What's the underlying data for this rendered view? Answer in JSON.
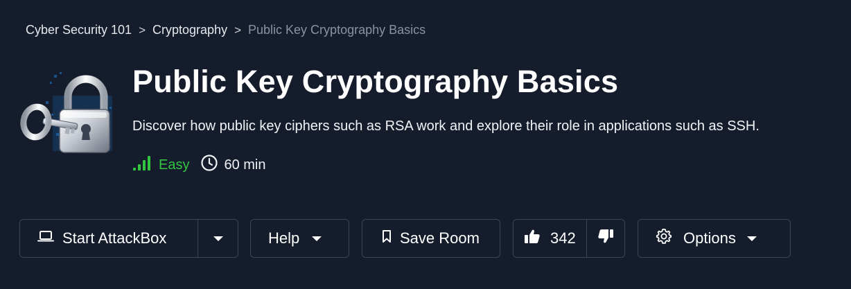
{
  "breadcrumb": {
    "items": [
      "Cyber Security 101",
      "Cryptography",
      "Public Key Cryptography Basics"
    ],
    "separator": ">"
  },
  "room": {
    "title": "Public Key Cryptography Basics",
    "description": "Discover how public key ciphers such as RSA work and explore their role in applications such as SSH.",
    "difficulty": "Easy",
    "duration": "60 min",
    "icon": "padlock-with-key-icon"
  },
  "toolbar": {
    "start_attackbox_label": "Start AttackBox",
    "help_label": "Help",
    "save_room_label": "Save Room",
    "like_count": "342",
    "options_label": "Options"
  },
  "colors": {
    "background": "#151c2b",
    "border": "#3b4456",
    "easy_green": "#33c642",
    "breadcrumb_current": "#8a93a3"
  }
}
